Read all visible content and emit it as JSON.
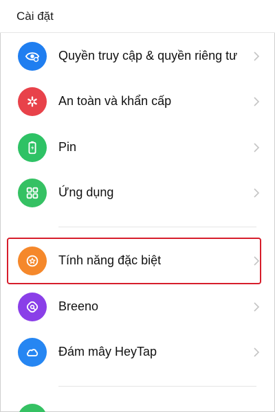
{
  "header": {
    "title": "Cài đặt"
  },
  "items": [
    {
      "label": "Quyền truy cập & quyền riêng tư",
      "icon": "eye-privacy-icon",
      "color": "#1f7ef0"
    },
    {
      "label": "An toàn và khẩn cấp",
      "icon": "asterisk-emergency-icon",
      "color": "#e8424a"
    },
    {
      "label": "Pin",
      "icon": "battery-icon",
      "color": "#2ec265"
    },
    {
      "label": "Ứng dụng",
      "icon": "apps-grid-icon",
      "color": "#35c163"
    },
    {
      "label": "Tính năng đặc biệt",
      "icon": "star-circle-icon",
      "color": "#f5882b"
    },
    {
      "label": "Breeno",
      "icon": "breeno-icon",
      "color": "#8a3fe8"
    },
    {
      "label": "Đám mây HeyTap",
      "icon": "cloud-icon",
      "color": "#2686f2"
    },
    {
      "icon": "partial-icon",
      "color": "#35c163"
    }
  ],
  "highlighted_item": "Tính năng đặc biệt",
  "highlight_color": "#d61d2b"
}
